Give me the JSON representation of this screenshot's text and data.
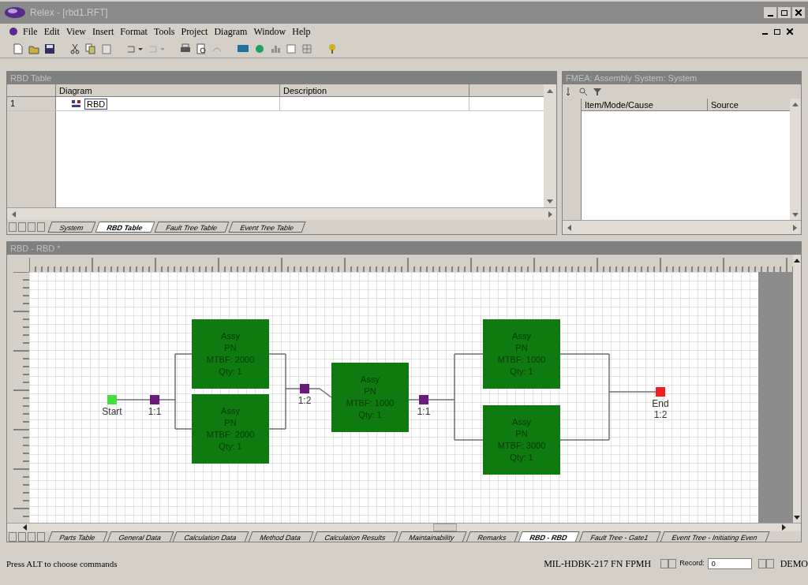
{
  "window": {
    "title": "Relex - [rbd1.RFT]"
  },
  "menu": [
    "File",
    "Edit",
    "View",
    "Insert",
    "Format",
    "Tools",
    "Project",
    "Diagram",
    "Window",
    "Help"
  ],
  "rbd_table": {
    "title": "RBD Table",
    "columns": [
      "Diagram",
      "Description"
    ],
    "rows": [
      {
        "number": "1",
        "diagram": "RBD"
      }
    ],
    "tabs": [
      {
        "label": "System",
        "selected": false
      },
      {
        "label": "RBD Table",
        "selected": true
      },
      {
        "label": "Fault Tree Table",
        "selected": false
      },
      {
        "label": "Event Tree Table",
        "selected": false
      }
    ]
  },
  "fmea": {
    "title": "FMEA: Assembly System: System",
    "columns": [
      "Item/Mode/Cause",
      "Source"
    ]
  },
  "diagram": {
    "title": "RBD - RBD *",
    "nodes": [
      {
        "kind": "start",
        "label": "Start"
      },
      {
        "kind": "connector",
        "label": "1:1"
      },
      {
        "kind": "connector",
        "label": "1:2"
      },
      {
        "kind": "connector",
        "label": "1:1"
      },
      {
        "kind": "end",
        "label": "End",
        "ratio": "1:2"
      }
    ],
    "blocks": [
      {
        "lines": [
          "Assy",
          "PN",
          "MTBF: 2000",
          "Qty: 1"
        ]
      },
      {
        "lines": [
          "Assy",
          "PN",
          "MTBF: 2000",
          "Qty: 1"
        ]
      },
      {
        "lines": [
          "Assy",
          "PN",
          "MTBF: 1000",
          "Qty: 1"
        ]
      },
      {
        "lines": [
          "Assy",
          "PN",
          "MTBF: 1000",
          "Qty: 1"
        ]
      },
      {
        "lines": [
          "Assy",
          "PN",
          "MTBF: 3000",
          "Qty: 1"
        ]
      }
    ]
  },
  "bottom_tabs": [
    {
      "label": "Parts Table",
      "selected": false
    },
    {
      "label": "General Data",
      "selected": false
    },
    {
      "label": "Calculation Data",
      "selected": false
    },
    {
      "label": "Method Data",
      "selected": false
    },
    {
      "label": "Calculation Results",
      "selected": false
    },
    {
      "label": "Maintainability",
      "selected": false
    },
    {
      "label": "Remarks",
      "selected": false
    },
    {
      "label": "RBD - RBD",
      "selected": true
    },
    {
      "label": "Fault Tree - Gate1",
      "selected": false
    },
    {
      "label": "Event Tree - Initiating Even",
      "selected": false
    }
  ],
  "status_bar": {
    "message": "Press ALT to choose commands",
    "method": "MIL-HDBK-217 FN FPMH",
    "record_label": "Record:",
    "record": "0",
    "mode": "DEMO"
  }
}
